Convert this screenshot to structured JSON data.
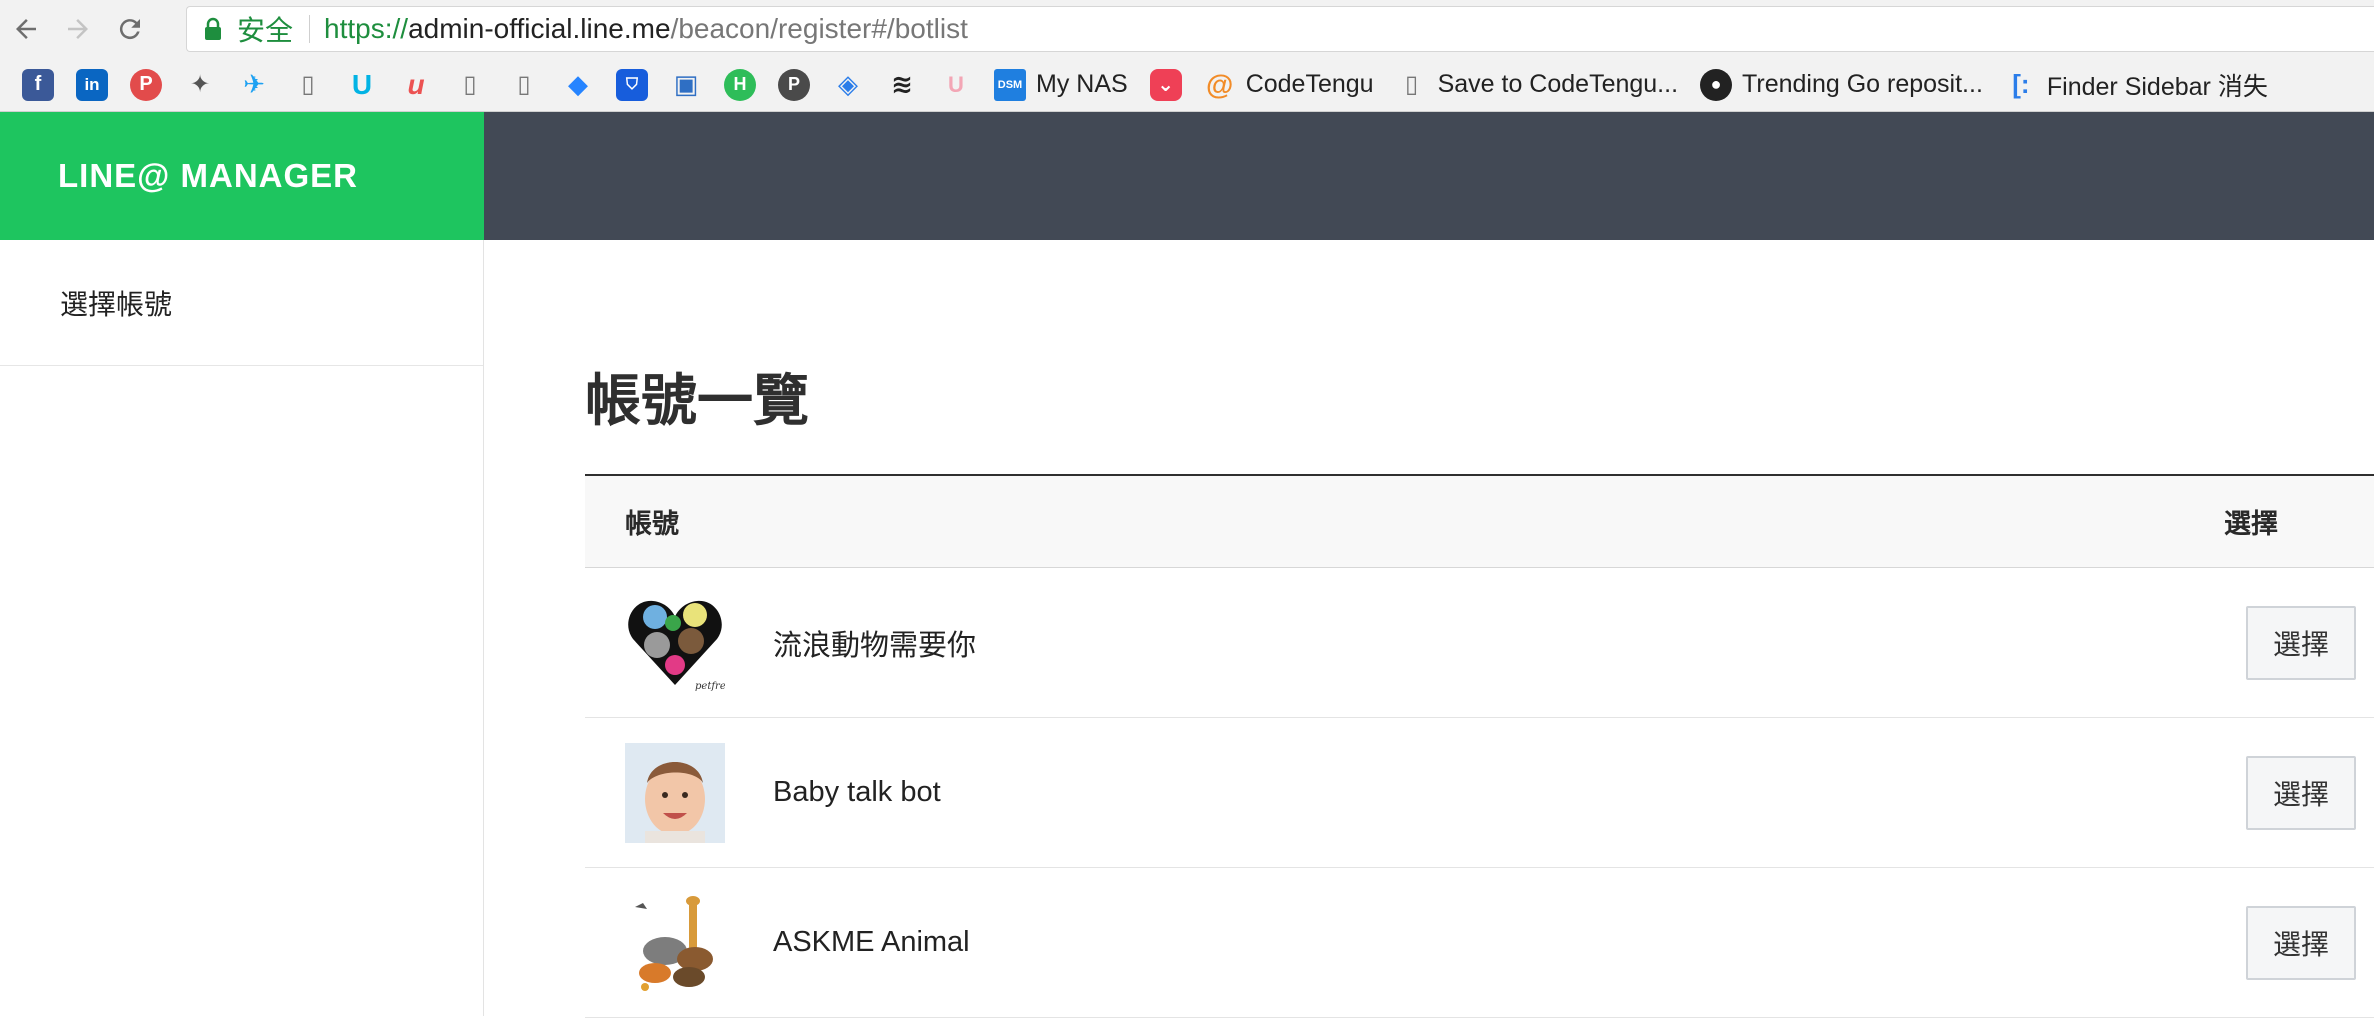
{
  "browser": {
    "secure_label": "安全",
    "url_scheme": "https://",
    "url_host": "admin-official.line.me",
    "url_path": "/beacon/register#/botlist"
  },
  "bookmarks": [
    {
      "icon": "facebook-icon",
      "label": ""
    },
    {
      "icon": "linkedin-icon",
      "label": ""
    },
    {
      "icon": "pinboard-icon",
      "label": ""
    },
    {
      "icon": "mosquito-icon",
      "label": ""
    },
    {
      "icon": "twitter-icon",
      "label": ""
    },
    {
      "icon": "page-icon",
      "label": ""
    },
    {
      "icon": "udacity-icon",
      "label": ""
    },
    {
      "icon": "udemy-icon",
      "label": ""
    },
    {
      "icon": "page-icon",
      "label": ""
    },
    {
      "icon": "page-icon",
      "label": ""
    },
    {
      "icon": "jira-icon",
      "label": ""
    },
    {
      "icon": "bitwarden-icon",
      "label": ""
    },
    {
      "icon": "chip-icon",
      "label": ""
    },
    {
      "icon": "hex-icon",
      "label": ""
    },
    {
      "icon": "producthunt-icon",
      "label": ""
    },
    {
      "icon": "layers-icon",
      "label": ""
    },
    {
      "icon": "buffer-icon",
      "label": ""
    },
    {
      "icon": "u-icon",
      "label": ""
    },
    {
      "icon": "dsm-icon",
      "label": "My NAS"
    },
    {
      "icon": "pocket-icon",
      "label": ""
    },
    {
      "icon": "codetengu-icon",
      "label": "CodeTengu"
    },
    {
      "icon": "page-icon",
      "label": "Save to CodeTengu..."
    },
    {
      "icon": "github-icon",
      "label": "Trending Go reposit..."
    },
    {
      "icon": "finder-icon",
      "label": "Finder Sidebar 消失"
    }
  ],
  "header": {
    "brand": "LINE@ MANAGER"
  },
  "sidebar": {
    "items": [
      {
        "label": "選擇帳號"
      }
    ]
  },
  "main": {
    "title": "帳號一覽",
    "table": {
      "col_account": "帳號",
      "col_select": "選擇",
      "rows": [
        {
          "name": "流浪動物需要你",
          "button": "選擇"
        },
        {
          "name": "Baby talk bot",
          "button": "選擇"
        },
        {
          "name": "ASKME Animal",
          "button": "選擇"
        }
      ]
    }
  },
  "colors": {
    "brand_green": "#1ec55f",
    "header_dark": "#424955"
  }
}
